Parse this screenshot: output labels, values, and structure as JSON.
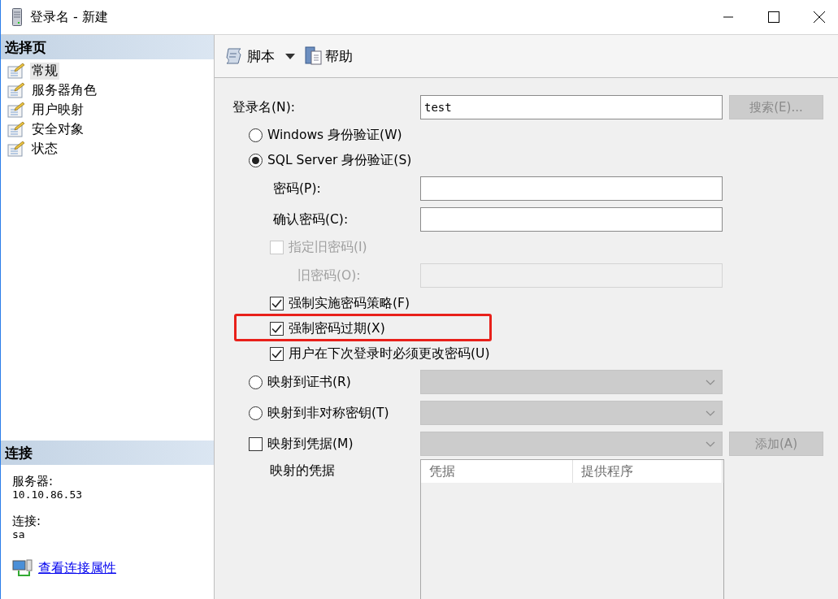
{
  "window": {
    "title": "登录名 - 新建"
  },
  "sidebar": {
    "header": "选择页",
    "items": [
      {
        "label": "常规",
        "selected": true
      },
      {
        "label": "服务器角色",
        "selected": false
      },
      {
        "label": "用户映射",
        "selected": false
      },
      {
        "label": "安全对象",
        "selected": false
      },
      {
        "label": "状态",
        "selected": false
      }
    ]
  },
  "connection": {
    "header": "连接",
    "server_label": "服务器:",
    "server": "10.10.86.53",
    "connection_label": "连接:",
    "user": "sa",
    "link": "查看连接属性"
  },
  "toolbar": [
    {
      "kind": "script",
      "label": "脚本",
      "has_menu": true
    },
    {
      "kind": "help",
      "label": "帮助",
      "has_menu": false
    }
  ],
  "form": {
    "rows": [
      {
        "kind": "field",
        "label": "登录名(N):",
        "input": {
          "kind": "text",
          "value": "test",
          "disabled": false
        },
        "button": {
          "label": "搜索(E)...",
          "disabled": true
        }
      },
      {
        "kind": "radio",
        "label": "Windows 身份验证(W)",
        "selected": false
      },
      {
        "kind": "radio",
        "label": "SQL Server 身份验证(S)",
        "selected": true,
        "children": [
          {
            "kind": "field",
            "label": "密码(P):",
            "input": {
              "kind": "text",
              "disabled": false
            }
          },
          {
            "kind": "field",
            "label": "确认密码(C):",
            "input": {
              "kind": "text",
              "disabled": false
            }
          },
          {
            "kind": "checkbox",
            "label": "指定旧密码(I)",
            "checked": false,
            "disabled": true,
            "children": [
              {
                "kind": "field",
                "label": "旧密码(O):",
                "disabled": true,
                "input": {
                  "kind": "text",
                  "disabled": true
                }
              }
            ]
          },
          {
            "kind": "checkbox",
            "label": "强制实施密码策略(F)",
            "checked": true,
            "disabled": false
          },
          {
            "kind": "checkbox",
            "label": "强制密码过期(X)",
            "checked": true,
            "disabled": false,
            "highlighted": true
          },
          {
            "kind": "checkbox",
            "label": "用户在下次登录时必须更改密码(U)",
            "checked": true,
            "disabled": false
          }
        ]
      },
      {
        "kind": "radio",
        "label": "映射到证书(R)",
        "selected": false,
        "input": {
          "kind": "combo",
          "disabled": true
        }
      },
      {
        "kind": "radio",
        "label": "映射到非对称密钥(T)",
        "selected": false,
        "input": {
          "kind": "combo",
          "disabled": true
        }
      },
      {
        "kind": "checkbox",
        "label": "映射到凭据(M)",
        "checked": false,
        "disabled": false,
        "input": {
          "kind": "combo",
          "disabled": true
        },
        "button": {
          "label": "添加(A)",
          "disabled": true
        }
      },
      {
        "kind": "grid",
        "label": "映射的凭据",
        "columns": [
          "凭据",
          "提供程序"
        ]
      }
    ]
  }
}
